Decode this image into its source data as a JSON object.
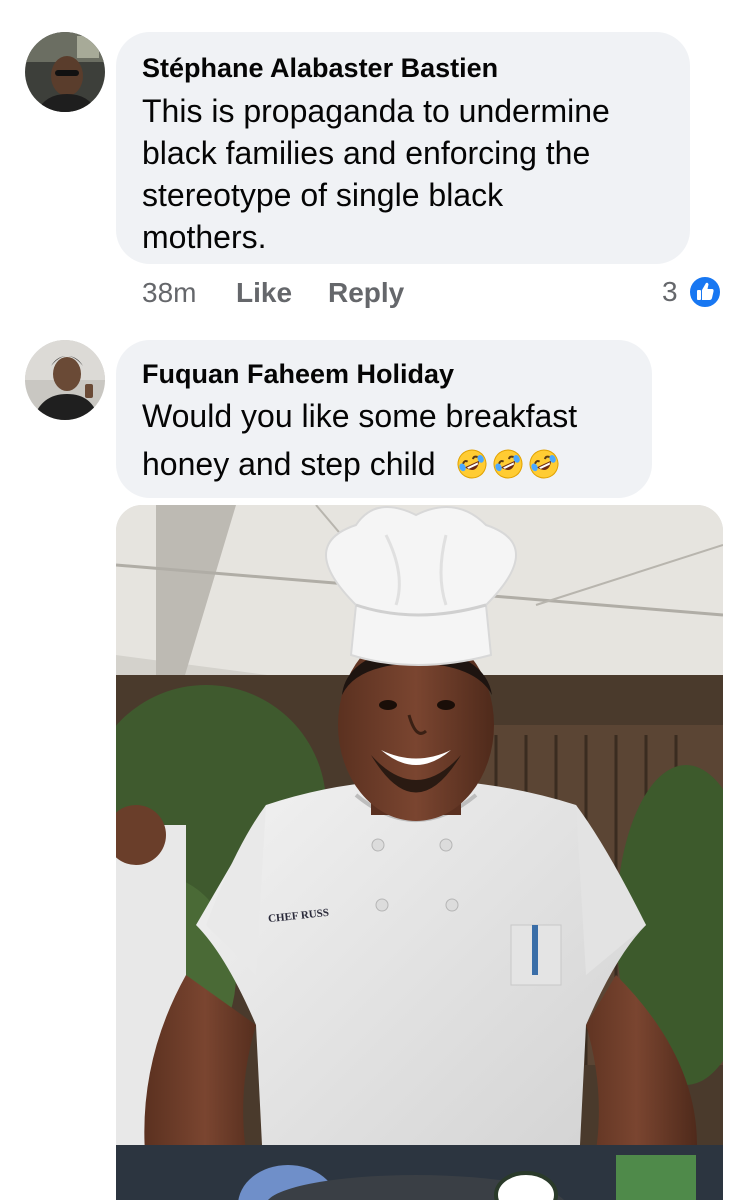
{
  "comments": [
    {
      "author": "Stéphane Alabaster Bastien",
      "text_lines": [
        "This is propaganda to undermine",
        "black families and enforcing the",
        "stereotype of single black",
        "mothers."
      ],
      "time": "38m",
      "like_label": "Like",
      "reply_label": "Reply",
      "reaction_count": "3",
      "reaction_icon": "thumbs-up-icon",
      "reaction_color": "#1877f2"
    },
    {
      "author": "Fuquan Faheem Holiday",
      "text_lines": [
        "Would you like some breakfast",
        "honey and step child"
      ],
      "emojis": [
        "rolling-on-floor-laughing-emoji",
        "rolling-on-floor-laughing-emoji",
        "rolling-on-floor-laughing-emoji"
      ],
      "attachment": {
        "type": "photo",
        "label": "CHEF RUSS"
      }
    }
  ],
  "colors": {
    "bubble": "#f0f2f5",
    "text": "#050505",
    "meta": "#65676b",
    "accent": "#1877f2"
  }
}
